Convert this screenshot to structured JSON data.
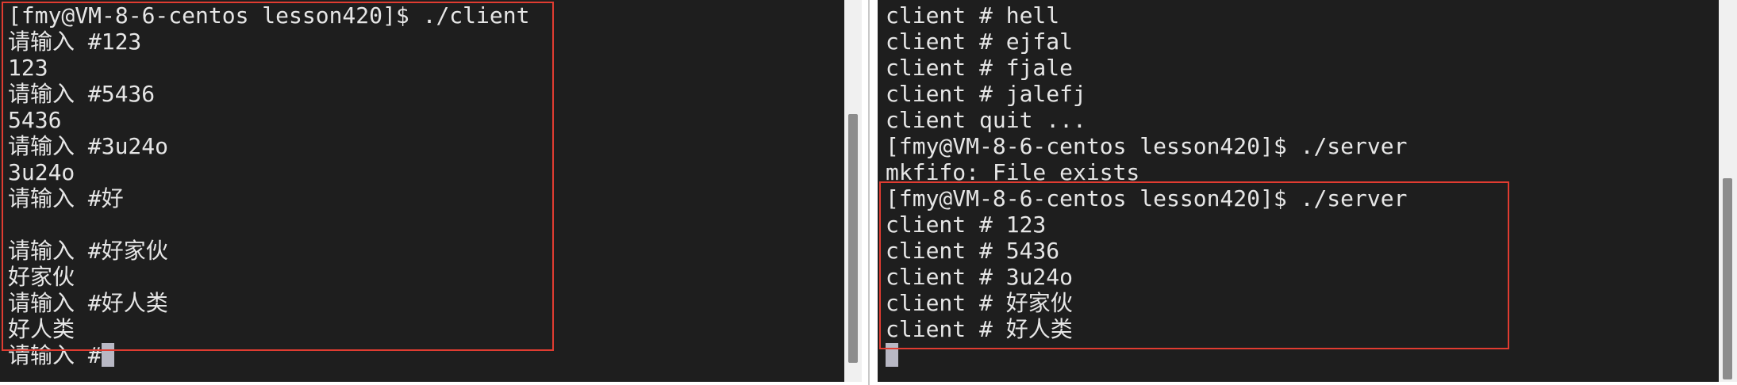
{
  "left_terminal": {
    "lines": [
      "[fmy@VM-8-6-centos lesson420]$ ./client",
      "请输入 #123",
      "123",
      "请输入 #5436",
      "5436",
      "请输入 #3u24o",
      "3u24o",
      "请输入 #好",
      "",
      "请输入 #好家伙",
      "好家伙",
      "请输入 #好人类",
      "好人类"
    ],
    "prompt_line": "请输入 #"
  },
  "right_terminal": {
    "lines": [
      "client # hell",
      "client # ejfal",
      "client # fjale",
      "client # jalefj",
      "client quit ...",
      "[fmy@VM-8-6-centos lesson420]$ ./server",
      "mkfifo: File exists",
      "[fmy@VM-8-6-centos lesson420]$ ./server",
      "client # 123",
      "client # 5436",
      "client # 3u24o",
      "client # 好家伙",
      "client # 好人类"
    ]
  },
  "colors": {
    "terminal_background": "#1e1e1e",
    "terminal_text": "#e6e6e6",
    "highlight_border": "#e03c31",
    "cursor": "#b8b8c4",
    "scrollbar_track": "#f0f0f0",
    "scrollbar_thumb": "#8c8c8c"
  }
}
